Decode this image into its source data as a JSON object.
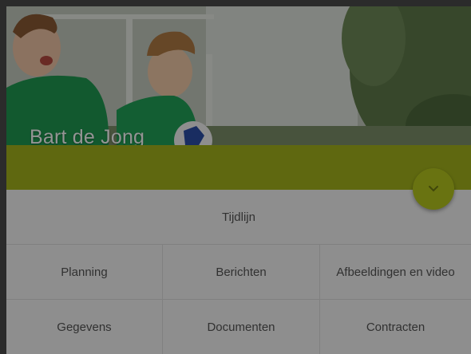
{
  "profile": {
    "name": "Bart de Jong",
    "cover_image": "kids-playing-soccer-photo"
  },
  "header": {
    "expand_icon": "chevron-down-icon",
    "accent_color": "#a4b41c"
  },
  "nav": {
    "timeline": "Tijdlijn",
    "items": [
      {
        "label": "Planning"
      },
      {
        "label": "Berichten"
      },
      {
        "label": "Afbeeldingen en video"
      },
      {
        "label": "Gegevens"
      },
      {
        "label": "Documenten"
      },
      {
        "label": "Contracten"
      }
    ]
  }
}
